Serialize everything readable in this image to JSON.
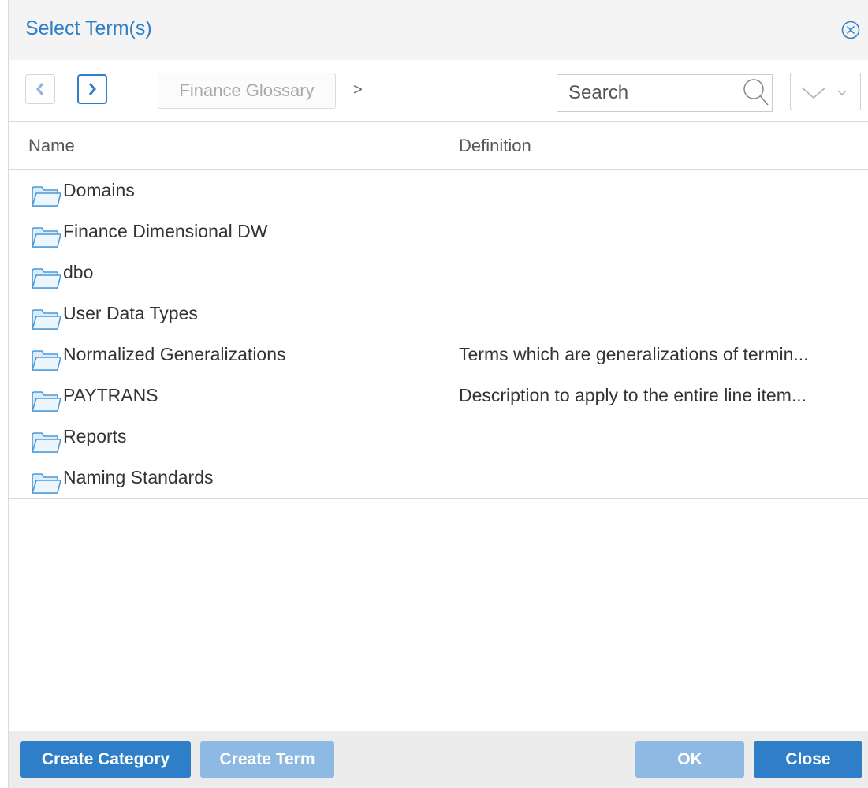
{
  "dialog": {
    "title": "Select Term(s)"
  },
  "toolbar": {
    "breadcrumb": "Finance Glossary",
    "breadcrumb_separator": ">",
    "search_placeholder": "Search"
  },
  "grid": {
    "columns": [
      "Name",
      "Definition"
    ],
    "rows": [
      {
        "name": "Domains",
        "definition": ""
      },
      {
        "name": "Finance Dimensional DW",
        "definition": ""
      },
      {
        "name": "dbo",
        "definition": ""
      },
      {
        "name": "User Data Types",
        "definition": ""
      },
      {
        "name": "Normalized Generalizations",
        "definition": "Terms which are generalizations of termin..."
      },
      {
        "name": "PAYTRANS",
        "definition": "Description to apply to the entire line item..."
      },
      {
        "name": "Reports",
        "definition": ""
      },
      {
        "name": "Naming Standards",
        "definition": ""
      }
    ]
  },
  "footer": {
    "create_category": "Create Category",
    "create_term": "Create Term",
    "ok": "OK",
    "close": "Close"
  },
  "colors": {
    "accent": "#2f7fc8",
    "accent_disabled": "#8db9e3",
    "folder": "#4a9ad8"
  }
}
